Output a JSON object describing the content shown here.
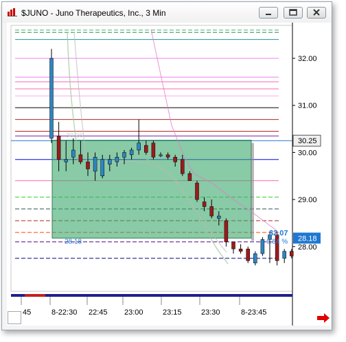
{
  "window": {
    "title": "$JUNO - Juno Therapeutics, Inc., 3 Min",
    "minimize_icon": "minimize-icon",
    "maximize_icon": "maximize-icon",
    "close_icon": "close-icon"
  },
  "price_axis": {
    "labels": [
      "32.00",
      "31.00",
      "30.00",
      "29.00",
      "28.00"
    ],
    "current_price_tag": "30.25",
    "last_price_tag": "28.18",
    "tag_color": "#1f78d1"
  },
  "time_axis": {
    "labels": [
      "45",
      "8-22:30",
      "22:45",
      "23:00",
      "23:15",
      "23:30",
      "8-23:45"
    ]
  },
  "annotations": {
    "top_price_label": "30.26",
    "bottom_price_label": "28.18",
    "change_label": "$2.07",
    "change_pct_label": "6.84 %"
  },
  "scroll_arrow_icon": "right-arrow-icon",
  "chart_data": {
    "type": "candlestick",
    "title": "",
    "ylim": [
      27.05,
      32.7
    ],
    "y_ticks": [
      32.0,
      31.0,
      30.0,
      29.0,
      28.0
    ],
    "x_ticks": [
      "45",
      "8-22:30",
      "22:45",
      "23:00",
      "23:15",
      "23:30",
      "8-23:45"
    ],
    "candles": [
      {
        "o": 30.3,
        "h": 32.2,
        "l": 30.2,
        "c": 32.0
      },
      {
        "o": 30.35,
        "h": 30.65,
        "l": 29.6,
        "c": 29.85
      },
      {
        "o": 29.8,
        "h": 30.25,
        "l": 29.6,
        "c": 29.85
      },
      {
        "o": 29.9,
        "h": 30.3,
        "l": 29.75,
        "c": 30.05
      },
      {
        "o": 29.95,
        "h": 30.25,
        "l": 29.75,
        "c": 29.8
      },
      {
        "o": 29.8,
        "h": 30.0,
        "l": 29.5,
        "c": 29.65
      },
      {
        "o": 29.6,
        "h": 30.0,
        "l": 29.4,
        "c": 29.9
      },
      {
        "o": 29.5,
        "h": 29.95,
        "l": 29.45,
        "c": 29.85
      },
      {
        "o": 29.75,
        "h": 29.95,
        "l": 29.6,
        "c": 29.85
      },
      {
        "o": 29.8,
        "h": 30.0,
        "l": 29.7,
        "c": 29.9
      },
      {
        "o": 29.9,
        "h": 30.05,
        "l": 29.75,
        "c": 30.0
      },
      {
        "o": 29.95,
        "h": 30.1,
        "l": 29.85,
        "c": 30.05
      },
      {
        "o": 30.05,
        "h": 30.7,
        "l": 29.95,
        "c": 30.2
      },
      {
        "o": 30.15,
        "h": 30.25,
        "l": 29.95,
        "c": 30.0
      },
      {
        "o": 30.2,
        "h": 30.25,
        "l": 29.85,
        "c": 29.9
      },
      {
        "o": 29.95,
        "h": 30.0,
        "l": 29.9,
        "c": 29.95
      },
      {
        "o": 29.95,
        "h": 30.0,
        "l": 29.85,
        "c": 29.9
      },
      {
        "o": 29.9,
        "h": 29.95,
        "l": 29.7,
        "c": 29.8
      },
      {
        "o": 29.85,
        "h": 29.95,
        "l": 29.5,
        "c": 29.55
      },
      {
        "o": 29.55,
        "h": 29.6,
        "l": 29.4,
        "c": 29.4
      },
      {
        "o": 29.35,
        "h": 29.4,
        "l": 28.95,
        "c": 29.0
      },
      {
        "o": 28.95,
        "h": 29.05,
        "l": 28.75,
        "c": 28.85
      },
      {
        "o": 28.85,
        "h": 29.0,
        "l": 28.6,
        "c": 28.65
      },
      {
        "o": 28.6,
        "h": 28.75,
        "l": 28.45,
        "c": 28.65
      },
      {
        "o": 28.55,
        "h": 28.6,
        "l": 28.0,
        "c": 28.1
      },
      {
        "o": 28.1,
        "h": 28.1,
        "l": 27.85,
        "c": 27.95
      },
      {
        "o": 27.95,
        "h": 28.05,
        "l": 27.85,
        "c": 27.9
      },
      {
        "o": 27.95,
        "h": 28.0,
        "l": 27.65,
        "c": 27.7
      },
      {
        "o": 27.65,
        "h": 27.9,
        "l": 27.6,
        "c": 27.85
      },
      {
        "o": 27.85,
        "h": 28.2,
        "l": 27.8,
        "c": 28.15
      },
      {
        "o": 28.15,
        "h": 28.3,
        "l": 27.65,
        "c": 28.25
      },
      {
        "o": 28.25,
        "h": 28.3,
        "l": 27.6,
        "c": 27.7
      },
      {
        "o": 27.75,
        "h": 27.95,
        "l": 27.65,
        "c": 27.9
      },
      {
        "o": 27.9,
        "h": 27.95,
        "l": 27.75,
        "c": 27.8
      }
    ],
    "up_color": "#2e86c1",
    "down_color": "#9c1b1b",
    "levels": [
      {
        "value": 32.6,
        "color": "#3cb371",
        "style": "dash"
      },
      {
        "value": 32.55,
        "color": "#2e8b57",
        "style": "dash"
      },
      {
        "value": 32.4,
        "color": "#1e90a0",
        "style": "solid"
      },
      {
        "value": 32.0,
        "color": "#ee82ee",
        "style": "solid"
      },
      {
        "value": 31.6,
        "color": "#ee82ee",
        "style": "solid"
      },
      {
        "value": 31.5,
        "color": "#ff69b4",
        "style": "solid"
      },
      {
        "value": 31.35,
        "color": "#ff69b4",
        "style": "solid"
      },
      {
        "value": 31.2,
        "color": "#ffaaee",
        "style": "solid"
      },
      {
        "value": 30.95,
        "color": "#000000",
        "style": "solid"
      },
      {
        "value": 30.7,
        "color": "#b22222",
        "style": "solid"
      },
      {
        "value": 30.45,
        "color": "#b22222",
        "style": "solid"
      },
      {
        "value": 30.35,
        "color": "#7b1fa2",
        "style": "solid"
      },
      {
        "value": 29.85,
        "color": "#0000ee",
        "style": "solid"
      },
      {
        "value": 29.4,
        "color": "#ff69b4",
        "style": "solid"
      },
      {
        "value": 29.05,
        "color": "#32cd32",
        "style": "dash"
      },
      {
        "value": 28.8,
        "color": "#2f4f4f",
        "style": "dash"
      },
      {
        "value": 28.55,
        "color": "#b22222",
        "style": "dash"
      },
      {
        "value": 28.3,
        "color": "#ff4500",
        "style": "dash"
      },
      {
        "value": 28.1,
        "color": "#4b0082",
        "style": "dash"
      },
      {
        "value": 27.75,
        "color": "#000080",
        "style": "dash"
      }
    ],
    "rectangle": {
      "top": 30.26,
      "bottom": 28.18,
      "color": "#3aa76d"
    }
  }
}
